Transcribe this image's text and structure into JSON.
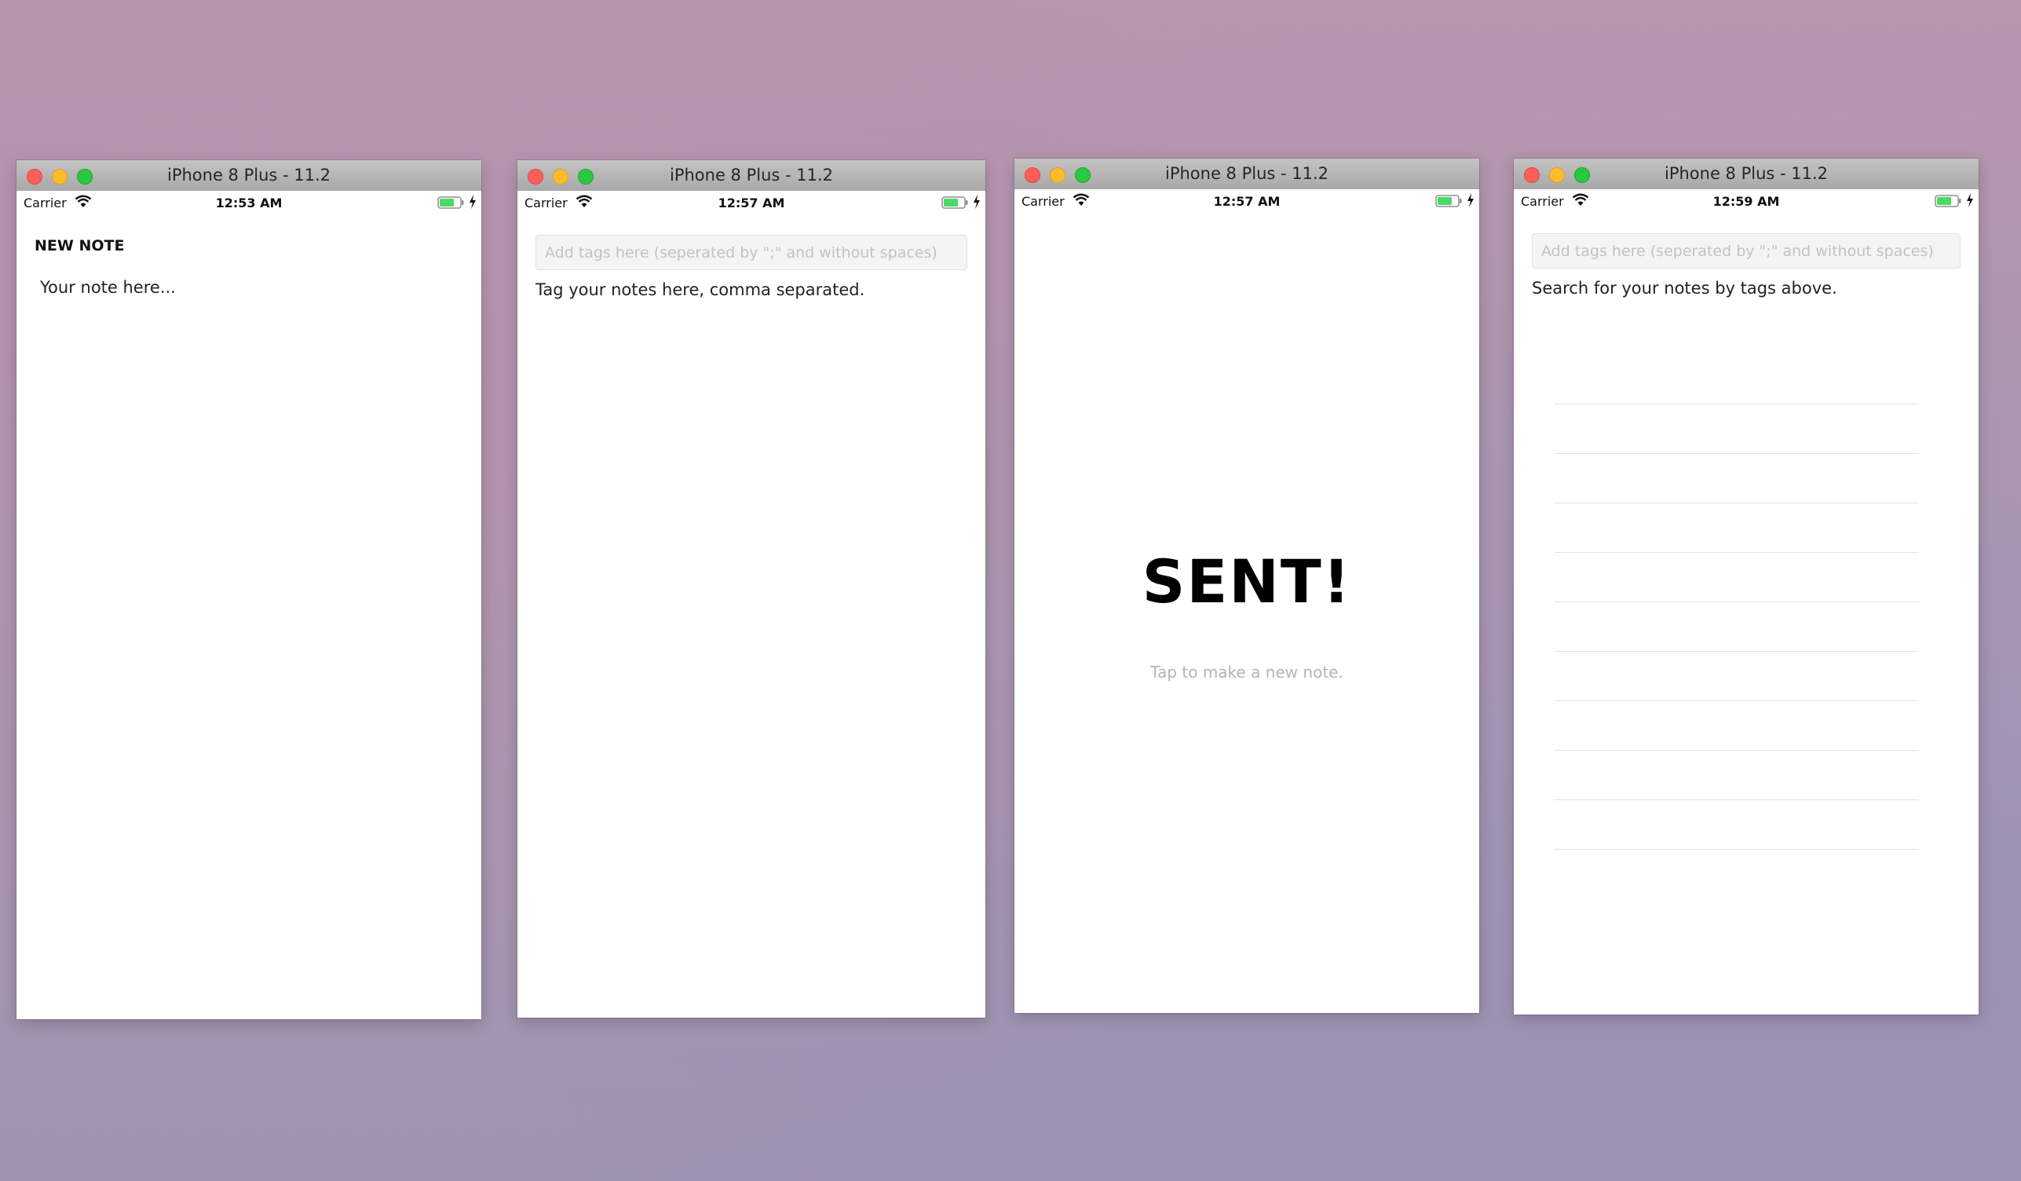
{
  "windows": [
    {
      "title": "iPhone 8 Plus - 11.2",
      "status": {
        "carrier": "Carrier",
        "time": "12:53 AM"
      },
      "screen": {
        "heading": "NEW NOTE",
        "body_text": "Your note here..."
      }
    },
    {
      "title": "iPhone 8 Plus - 11.2",
      "status": {
        "carrier": "Carrier",
        "time": "12:57 AM"
      },
      "screen": {
        "tag_input_placeholder": "Add tags here (seperated by \";\" and without spaces)",
        "tag_input_value": "",
        "hint": "Tag your notes here, comma separated."
      }
    },
    {
      "title": "iPhone 8 Plus - 11.2",
      "status": {
        "carrier": "Carrier",
        "time": "12:57 AM"
      },
      "screen": {
        "title": "SENT!",
        "subtitle": "Tap to make a new note."
      }
    },
    {
      "title": "iPhone 8 Plus - 11.2",
      "status": {
        "carrier": "Carrier",
        "time": "12:59 AM"
      },
      "screen": {
        "search_input_placeholder": "Add tags here (seperated by \";\" and without spaces)",
        "search_input_value": "",
        "hint": "Search for your notes by tags above.",
        "result_rows": 10
      }
    }
  ],
  "icons": {
    "close": "traffic-light-close-icon",
    "minimize": "traffic-light-minimize-icon",
    "zoom": "traffic-light-zoom-icon",
    "wifi": "wifi-icon",
    "battery": "battery-icon",
    "charging": "charging-bolt-icon"
  },
  "colors": {
    "close": "#fc5f57",
    "minimize": "#fdbc2e",
    "zoom": "#28c840",
    "battery_fill": "#4cd964",
    "desktop": "#ab97b1"
  }
}
